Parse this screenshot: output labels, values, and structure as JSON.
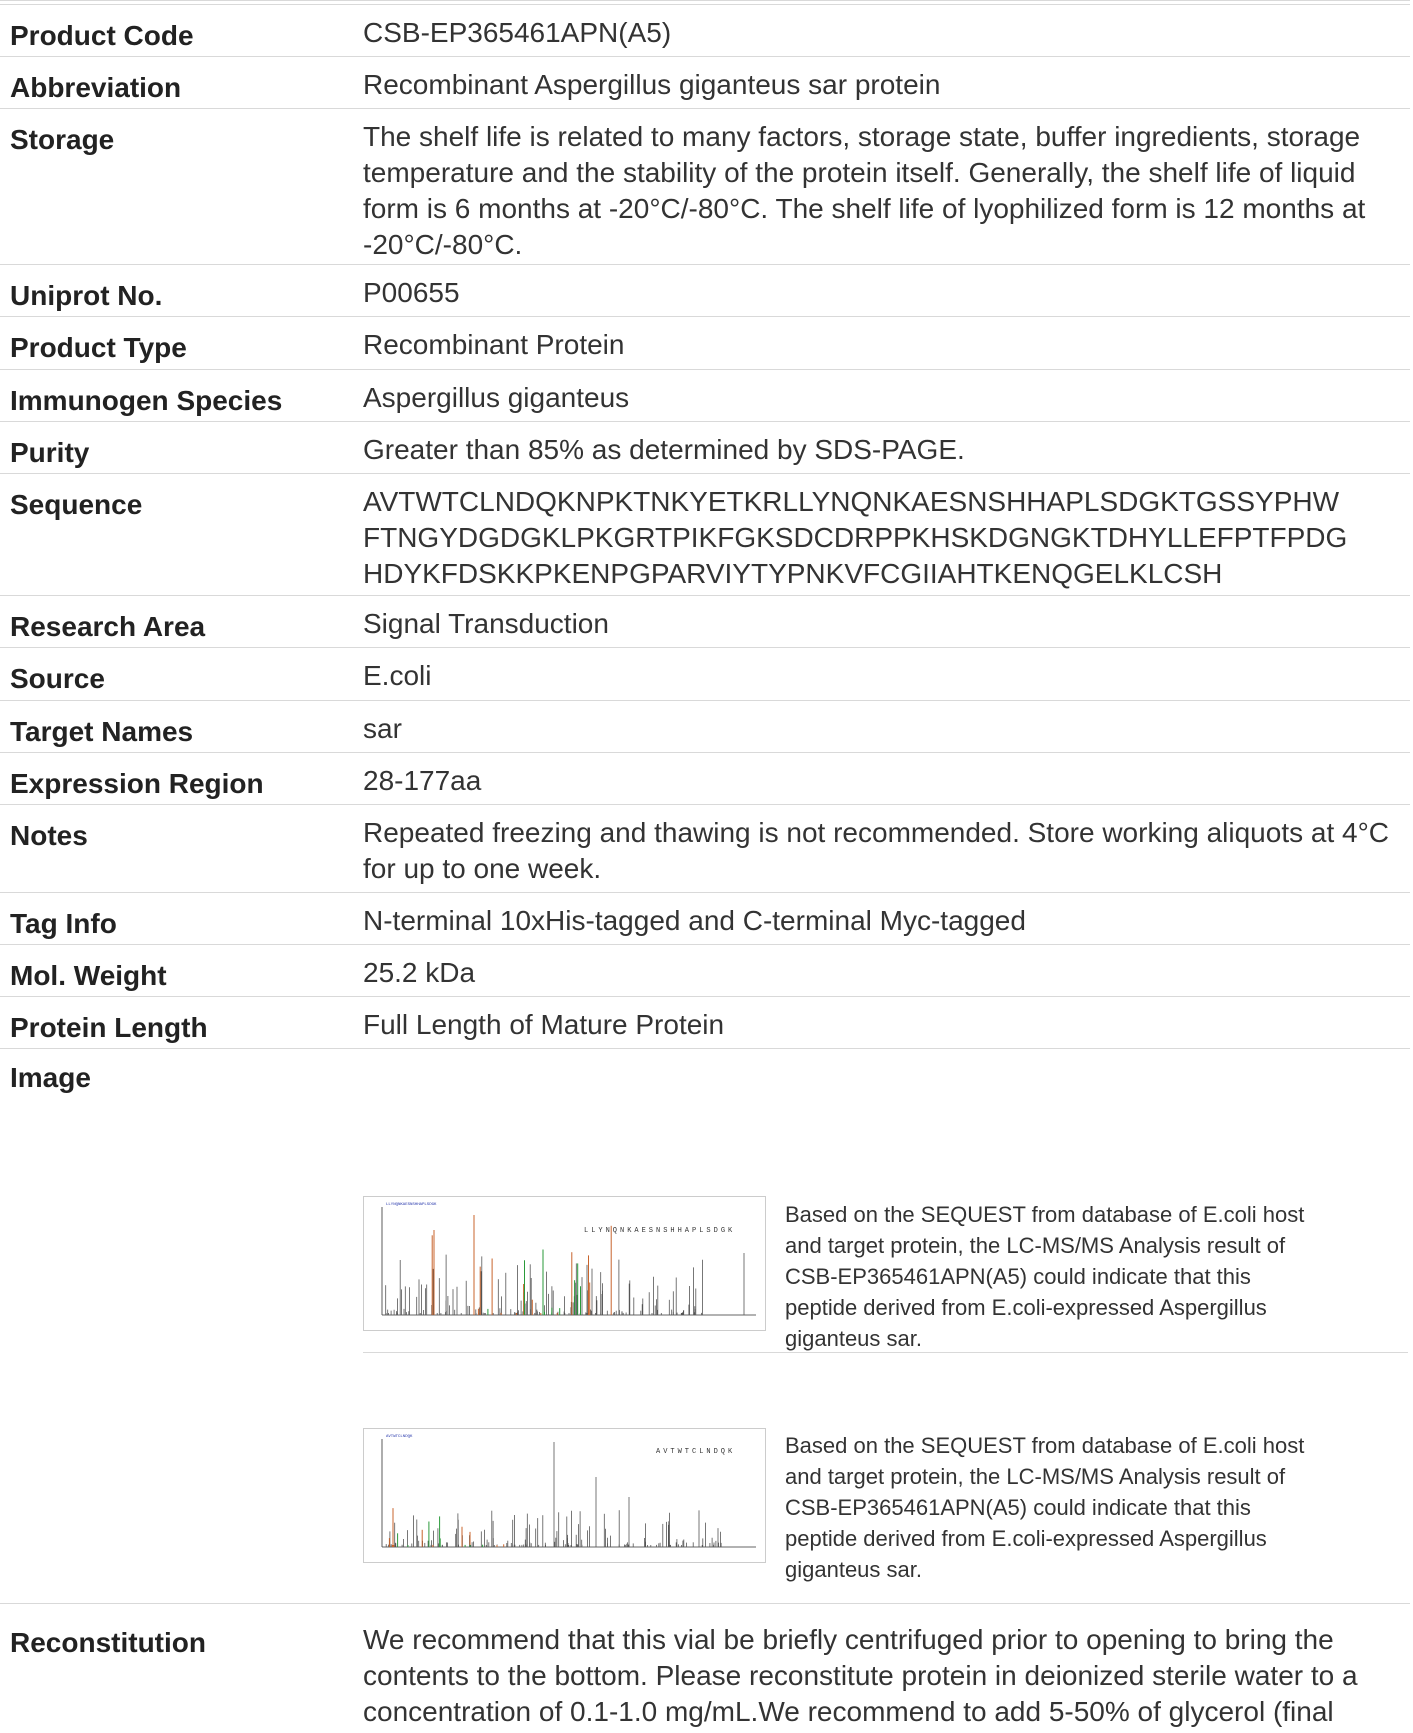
{
  "rows": [
    {
      "label": "Product Code",
      "value": "CSB-EP365461APN(A5)"
    },
    {
      "label": "Abbreviation",
      "value": "Recombinant Aspergillus giganteus sar protein"
    },
    {
      "label": "Storage",
      "value": "The shelf life is related to many factors, storage state, buffer ingredients, storage temperature and the stability of the protein itself. Generally, the shelf life of liquid form is 6 months at -20°C/-80°C. The shelf life of lyophilized form is 12 months at -20°C/-80°C."
    },
    {
      "label": "Uniprot No.",
      "value": "P00655"
    },
    {
      "label": "Product Type",
      "value": "Recombinant Protein"
    },
    {
      "label": "Immunogen Species",
      "value": "Aspergillus giganteus"
    },
    {
      "label": "Purity",
      "value": "Greater than 85% as determined by SDS-PAGE."
    },
    {
      "label": "Sequence",
      "value": "AVTWTCLNDQKNPKTNKYETKRLLYNQNKAESNSHHAPLSDGKTGSSYPHW FTNGYDGDGKLPKGRTPIKFGKSDCDRPPKHSKDGNGKTDHYLLEFPTFPDG HDYKFDSKKPKENPGPARVIYTYPNKVFCGIIAHTKENQGELKLCSH"
    },
    {
      "label": "Research Area",
      "value": "Signal Transduction"
    },
    {
      "label": "Source",
      "value": "E.coli"
    },
    {
      "label": "Target Names",
      "value": "sar"
    },
    {
      "label": "Expression Region",
      "value": "28-177aa"
    },
    {
      "label": "Notes",
      "value": "Repeated freezing and thawing is not recommended. Store working aliquots at 4°C for up to one week."
    },
    {
      "label": "Tag Info",
      "value": "N-terminal 10xHis-tagged and C-terminal Myc-tagged"
    },
    {
      "label": "Mol. Weight",
      "value": "25.2 kDa"
    },
    {
      "label": "Protein Length",
      "value": "Full Length of Mature Protein"
    }
  ],
  "image": {
    "label": "Image",
    "items": [
      {
        "caption": "Based on the SEQUEST from database of E.coli host and target protein, the LC-MS/MS Analysis result of CSB-EP365461APN(A5) could indicate that this peptide derived from E.coli-expressed Aspergillus giganteus sar.",
        "peptide": "LLYNQNKAESNSHHAPLSDGK"
      },
      {
        "caption": "Based on the SEQUEST from database of E.coli host and target protein, the LC-MS/MS Analysis result of CSB-EP365461APN(A5) could indicate that this peptide derived from E.coli-expressed Aspergillus giganteus sar.",
        "peptide": "AVTWTCLNDQK"
      }
    ]
  },
  "reconstitution": {
    "label": "Reconstitution",
    "value": "We recommend that this vial be briefly centrifuged prior to opening to bring the contents to the bottom. Please reconstitute protein in deionized sterile water to a concentration of 0.1-1.0 mg/mL.We recommend to add 5-50% of glycerol (final"
  }
}
